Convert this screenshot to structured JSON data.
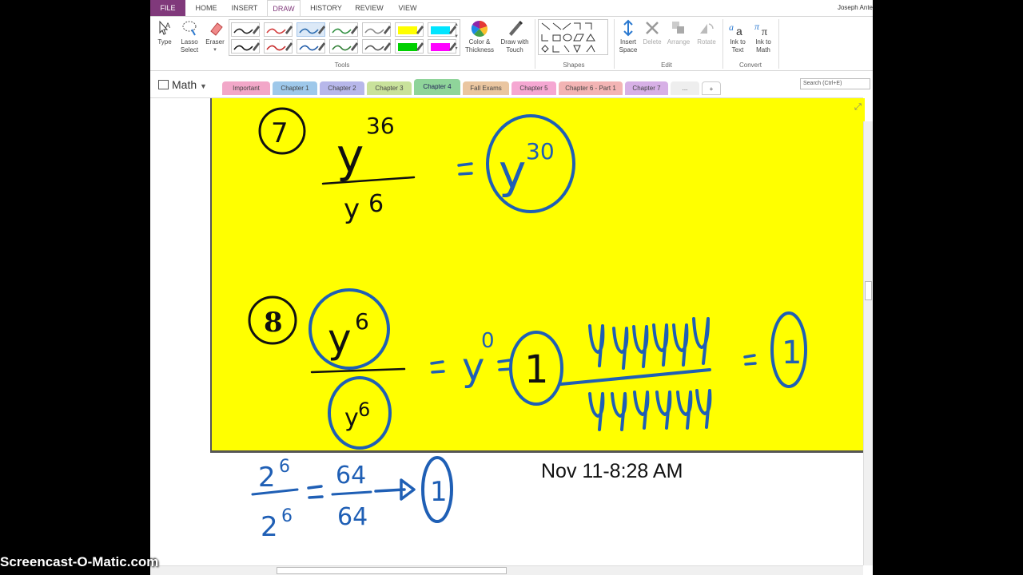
{
  "ribbon_tabs": [
    {
      "label": "FILE"
    },
    {
      "label": "HOME"
    },
    {
      "label": "INSERT"
    },
    {
      "label": "DRAW"
    },
    {
      "label": "HISTORY"
    },
    {
      "label": "REVIEW"
    },
    {
      "label": "VIEW"
    }
  ],
  "active_tab": "DRAW",
  "user_name": "Joseph Ante",
  "ribbon": {
    "type_label": "Type",
    "lasso_label": "Lasso Select",
    "eraser_label": "Eraser",
    "color_thickness_label": "Color & Thickness",
    "draw_touch_label": "Draw with Touch",
    "tools_group": "Tools",
    "shapes_group": "Shapes",
    "insert_space_label": "Insert Space",
    "delete_label": "Delete",
    "arrange_label": "Arrange",
    "rotate_label": "Rotate",
    "edit_group": "Edit",
    "ink_to_text_label": "Ink to Text",
    "ink_to_math_label": "Ink to Math",
    "convert_group": "Convert"
  },
  "pens": [
    {
      "color": "#222222",
      "kind": "pen"
    },
    {
      "color": "#d33b3b",
      "kind": "pen"
    },
    {
      "color": "#2b6cb0",
      "kind": "pen"
    },
    {
      "color": "#2f8f3f",
      "kind": "pen"
    },
    {
      "color": "#888888",
      "kind": "pen"
    },
    {
      "color": "#ffff00",
      "kind": "highlighter"
    },
    {
      "color": "#00e5ff",
      "kind": "highlighter"
    },
    {
      "color": "#111111",
      "kind": "pen"
    },
    {
      "color": "#c62828",
      "kind": "pen"
    },
    {
      "color": "#1e5aa8",
      "kind": "pen"
    },
    {
      "color": "#2e7d32",
      "kind": "pen"
    },
    {
      "color": "#555555",
      "kind": "pen"
    },
    {
      "color": "#00d000",
      "kind": "highlighter"
    },
    {
      "color": "#ff00ff",
      "kind": "highlighter"
    }
  ],
  "notebook": {
    "name": "Math"
  },
  "section_tabs": [
    {
      "label": "Important",
      "color": "#f2a7c8"
    },
    {
      "label": "Chapter 1",
      "color": "#9ec8ea"
    },
    {
      "label": "Chapter 2",
      "color": "#b7b7ea"
    },
    {
      "label": "Chapter 3",
      "color": "#c9e29b"
    },
    {
      "label": "Chapter 4",
      "color": "#8fd49a"
    },
    {
      "label": "Fall Exams",
      "color": "#eac6a0"
    },
    {
      "label": "Chapter 5",
      "color": "#f5a7d2"
    },
    {
      "label": "Chapter 6 - Part 1",
      "color": "#f3b4b4"
    },
    {
      "label": "Chapter 7",
      "color": "#d7b0e6"
    },
    {
      "label": "...",
      "color": "#eeeeee"
    },
    {
      "label": "+",
      "color": "#ffffff"
    }
  ],
  "active_section": "Chapter 4",
  "search_placeholder": "Search (Ctrl+E)",
  "page": {
    "timestamp": "Nov 11-8:28 AM",
    "problem_7": {
      "number": "7",
      "numerator": "y",
      "num_exp": "36",
      "denominator": "y",
      "den_exp": "6",
      "result": "y",
      "result_exp": "30"
    },
    "problem_8": {
      "number": "8",
      "base": "y",
      "exp": "6",
      "zero_exp": "0",
      "result": "1"
    },
    "side_note": {
      "numerator": "2",
      "num_exp": "6",
      "denominator": "2",
      "den_exp": "6",
      "value_top": "64",
      "value_bottom": "64",
      "result": "1"
    }
  },
  "watermark": "Screencast-O-Matic.com",
  "colors": {
    "file_tab": "#80397b",
    "ink_black": "#111111",
    "ink_blue": "#1f5fb5",
    "page_highlight": "#ffff00"
  }
}
